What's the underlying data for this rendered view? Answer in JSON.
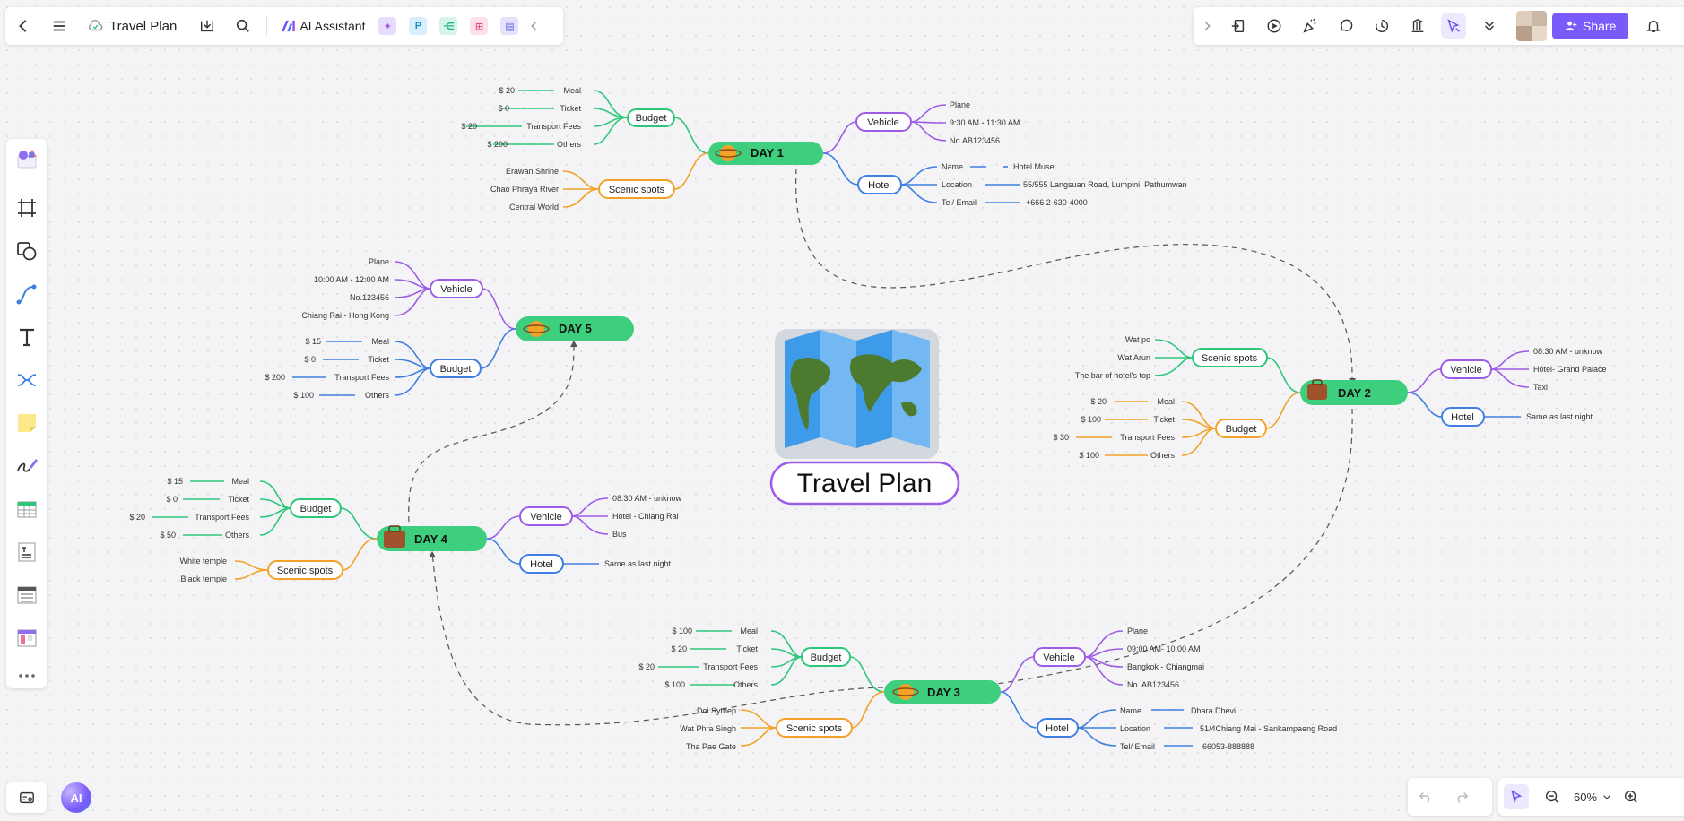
{
  "toolbar": {
    "doc_title": "Travel Plan",
    "ai_label": "AI Assistant",
    "share_label": "Share",
    "zoom": "60%"
  },
  "center_title": "Travel Plan",
  "days": {
    "day1": {
      "title": "DAY 1",
      "budget_label": "Budget",
      "budget": [
        {
          "amount": "$ 20",
          "item": "Meal"
        },
        {
          "amount": "$ 0",
          "item": "Ticket"
        },
        {
          "amount": "$ 20",
          "item": "Transport Fees"
        },
        {
          "amount": "$ 200",
          "item": "Others"
        }
      ],
      "scenic_label": "Scenic spots",
      "scenic": [
        "Erawan Shrine",
        "Chao Phraya River",
        "Central World"
      ],
      "vehicle_label": "Vehicle",
      "vehicle": [
        "Plane",
        "9:30 AM - 11:30 AM",
        "No.AB123456"
      ],
      "hotel_label": "Hotel",
      "hotel": [
        {
          "key": "Name",
          "value": "Hotel Muse"
        },
        {
          "key": "Location",
          "value": "55/555 Langsuan Road, Lumpini, Pathumwan"
        },
        {
          "key": "Tel/ Email",
          "value": "+666 2-630-4000"
        }
      ]
    },
    "day2": {
      "title": "DAY 2",
      "scenic_label": "Scenic spots",
      "scenic": [
        "Wat po",
        "Wat Arun",
        "The bar of hotel's top"
      ],
      "budget_label": "Budget",
      "budget": [
        {
          "amount": "$ 20",
          "item": "Meal"
        },
        {
          "amount": "$ 100",
          "item": "Ticket"
        },
        {
          "amount": "$ 30",
          "item": "Transport Fees"
        },
        {
          "amount": "$ 100",
          "item": "Others"
        }
      ],
      "vehicle_label": "Vehicle",
      "vehicle": [
        "08:30 AM - unknow",
        "Hotel- Grand Palace",
        "Taxi"
      ],
      "hotel_label": "Hotel",
      "hotel_note": "Same as last night"
    },
    "day3": {
      "title": "DAY 3",
      "budget_label": "Budget",
      "budget": [
        {
          "amount": "$ 100",
          "item": "Meal"
        },
        {
          "amount": "$ 20",
          "item": "Ticket"
        },
        {
          "amount": "$ 20",
          "item": "Transport Fees"
        },
        {
          "amount": "$ 100",
          "item": "Others"
        }
      ],
      "scenic_label": "Scenic spots",
      "scenic": [
        "Doi Sythep",
        "Wat Phra Singh",
        "Tha Pae Gate"
      ],
      "vehicle_label": "Vehicle",
      "vehicle": [
        "Plane",
        "09:00 AM- 10:00 AM",
        "Bangkok - Chiangmai",
        "No. AB123456"
      ],
      "hotel_label": "Hotel",
      "hotel": [
        {
          "key": "Name",
          "value": "Dhara Dhevi"
        },
        {
          "key": "Location",
          "value": "51/4Chiang Mai - Sankampaeng Road"
        },
        {
          "key": "Tel/ Email",
          "value": "66053-888888"
        }
      ]
    },
    "day4": {
      "title": "DAY 4",
      "budget_label": "Budget",
      "budget": [
        {
          "amount": "$ 15",
          "item": "Meal"
        },
        {
          "amount": "$ 0",
          "item": "Ticket"
        },
        {
          "amount": "$ 20",
          "item": "Transport Fees"
        },
        {
          "amount": "$ 50",
          "item": "Others"
        }
      ],
      "scenic_label": "Scenic spots",
      "scenic": [
        "White temple",
        "Black temple"
      ],
      "vehicle_label": "Vehicle",
      "vehicle": [
        "08:30 AM - unknow",
        "Hotel - Chiang Rai",
        "Bus"
      ],
      "hotel_label": "Hotel",
      "hotel_note": "Same as last night"
    },
    "day5": {
      "title": "DAY 5",
      "vehicle_label": "Vehicle",
      "vehicle": [
        "Plane",
        "10:00 AM - 12:00 AM",
        "No.123456",
        "Chiang Rai - Hong Kong"
      ],
      "budget_label": "Budget",
      "budget": [
        {
          "amount": "$ 15",
          "item": "Meal"
        },
        {
          "amount": "$ 0",
          "item": "Ticket"
        },
        {
          "amount": "$ 200",
          "item": "Transport Fees"
        },
        {
          "amount": "$ 100",
          "item": "Others"
        }
      ]
    }
  },
  "colors": {
    "day_node": "#3ecf7e",
    "budget": "#2dc77a",
    "scenic": "#f2a227",
    "vehicle": "#9d5ce6",
    "hotel": "#3f7fe0",
    "accent": "#7a5af8"
  }
}
